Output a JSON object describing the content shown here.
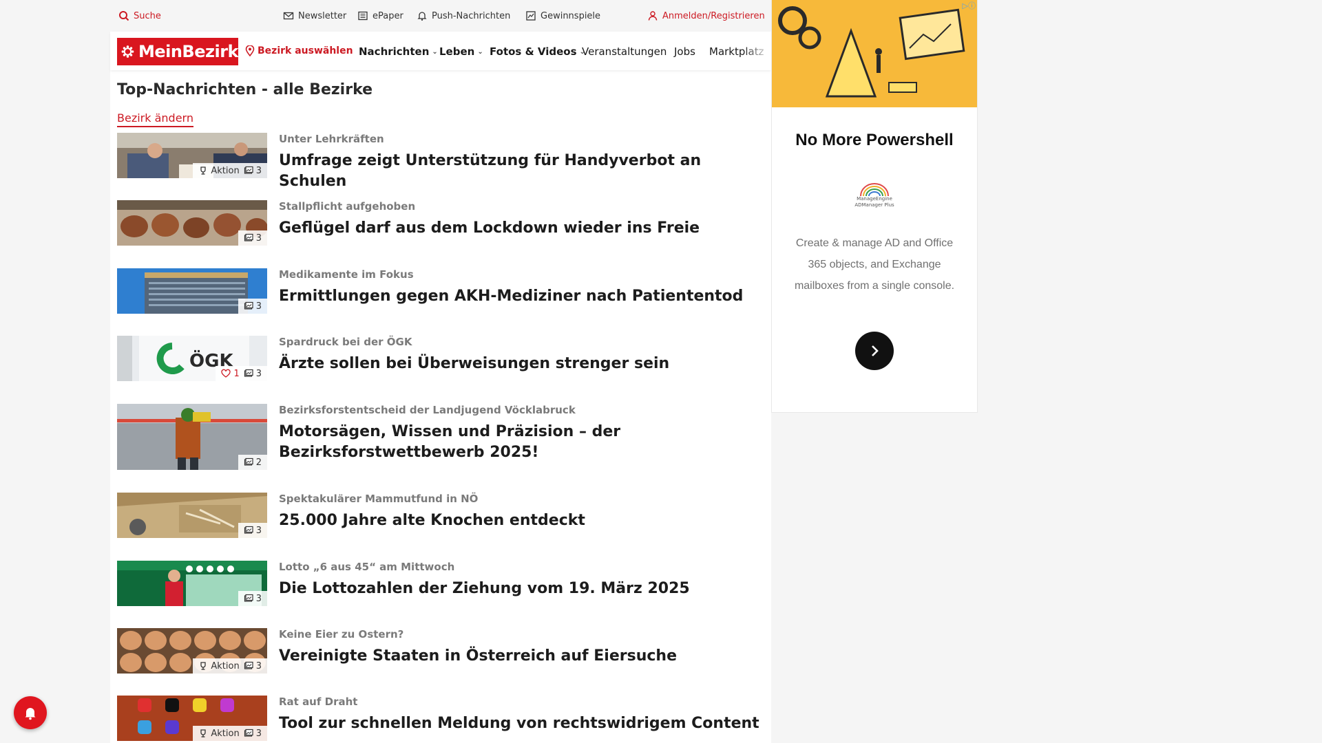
{
  "utility": {
    "search": "Suche",
    "newsletter": "Newsletter",
    "epaper": "ePaper",
    "push": "Push-Nachrichten",
    "games": "Gewinnspiele",
    "login": "Anmelden/Registrieren"
  },
  "nav": {
    "logo": "MeinBezirk",
    "select_district": "Bezirk auswählen",
    "news": "Nachrichten",
    "life": "Leben",
    "photos": "Fotos & Videos",
    "events": "Veranstaltungen",
    "jobs": "Jobs",
    "market": "Marktplatz"
  },
  "page": {
    "title": "Top-Nachrichten - alle Bezirke",
    "change_district": "Bezirk ändern"
  },
  "articles": [
    {
      "kicker": "Unter Lehrkräften",
      "headline": "Umfrage zeigt Unterstützung für Handyverbot an Schulen",
      "action": "Aktion",
      "photos": "3"
    },
    {
      "kicker": "Stallpflicht aufgehoben",
      "headline": "Geflügel darf aus dem Lockdown wieder ins Freie",
      "photos": "3"
    },
    {
      "kicker": "Medikamente im Fokus",
      "headline": "Ermittlungen gegen AKH-Mediziner nach Patiententod",
      "photos": "3"
    },
    {
      "kicker": "Spardruck bei der ÖGK",
      "headline": "Ärzte sollen bei Überweisungen strenger sein",
      "likes": "1",
      "photos": "3"
    },
    {
      "kicker": "Bezirksforstentscheid der Landjugend Vöcklabruck",
      "headline": "Motorsägen, Wissen und Präzision – der Bezirksforstwettbewerb 2025!",
      "photos": "2"
    },
    {
      "kicker": "Spektakulärer Mammutfund in NÖ",
      "headline": "25.000 Jahre alte Knochen entdeckt",
      "photos": "3"
    },
    {
      "kicker": "Lotto „6 aus 45“ am Mittwoch",
      "headline": "Die Lottozahlen der Ziehung vom 19. März 2025",
      "photos": "3"
    },
    {
      "kicker": "Keine Eier zu Ostern?",
      "headline": "Vereinigte Staaten in Österreich auf Eiersuche",
      "action": "Aktion",
      "photos": "3"
    },
    {
      "kicker": "Rat auf Draht",
      "headline": "Tool zur schnellen Meldung von rechtswidrigem Content",
      "action": "Aktion",
      "photos": "3"
    }
  ],
  "ad": {
    "title": "No More Powershell",
    "logo_line1": "ManageEngine",
    "logo_line2": "ADManager Plus",
    "text": "Create & manage AD and Office 365 objects, and Exchange mailboxes from a single console."
  },
  "colors": {
    "brand": "#d9161f",
    "link": "#cc1a23",
    "ad_bg": "#f7b93a"
  }
}
